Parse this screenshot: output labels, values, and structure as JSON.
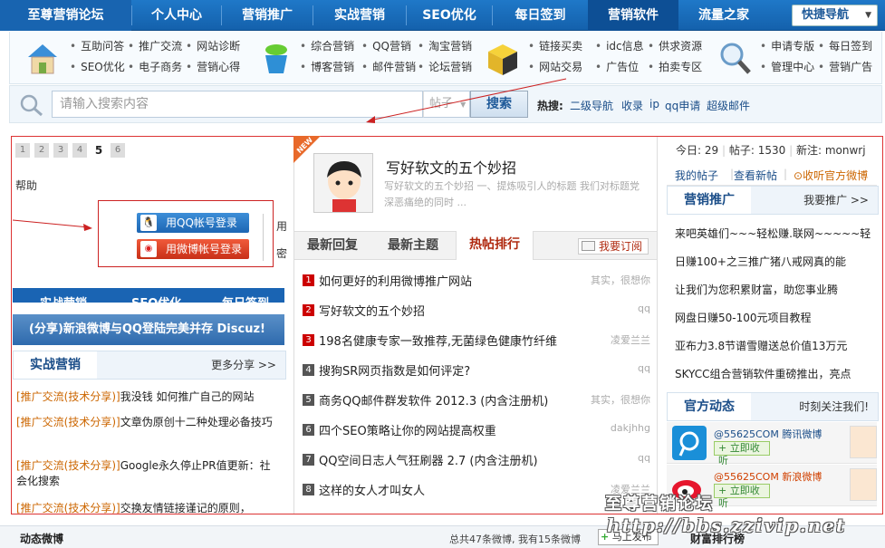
{
  "nav": {
    "items": [
      "至尊营销论坛",
      "个人中心",
      "营销推广",
      "实战营销",
      "SEO优化",
      "每日签到",
      "营销软件",
      "流量之家"
    ],
    "quick_nav": "快捷导航"
  },
  "categories": {
    "g1": [
      "互助问答",
      "推广交流",
      "网站诊断",
      "SEO优化",
      "电子商务",
      "营销心得"
    ],
    "g2": [
      "综合营销",
      "QQ营销",
      "淘宝营销",
      "博客营销",
      "邮件营销",
      "论坛营销"
    ],
    "g3": [
      "链接买卖",
      "idc信息",
      "供求资源",
      "网站交易",
      "广告位",
      "拍卖专区"
    ],
    "g4": [
      "申请专版",
      "每日签到",
      "管理中心",
      "营销广告"
    ]
  },
  "search": {
    "placeholder": "请输入搜索内容",
    "type": "帖子",
    "button": "搜索",
    "hot_label": "热搜:",
    "hot": [
      "二级导航",
      "收录",
      "ip",
      "qq申请",
      "超级邮件"
    ]
  },
  "left": {
    "pager": [
      "1",
      "2",
      "3",
      "4",
      "5",
      "6"
    ],
    "help": "帮助",
    "login_qq": "用QQ帐号登录",
    "login_weibo": "用微博帐号登录",
    "side_char1": "用",
    "side_char2": "密",
    "strip": [
      "实战营销",
      "SEO优化",
      "每日签到"
    ],
    "banner": "(分享)新浪微博与QQ登陆完美并存 Discuz!",
    "section_title": "实战营销",
    "section_more": "更多分享 >>",
    "items": [
      {
        "tag": "[推广交流(技术分享)]",
        "text": "我没钱 如何推广自己的网站"
      },
      {
        "tag": "[推广交流(技术分享)]",
        "text": "文章伪原创十二种处理必备技巧"
      },
      {
        "tag": "[推广交流(技术分享)]",
        "text": "Google永久停止PR值更新：社 会化搜索"
      },
      {
        "tag": "[推广交流(技术分享)]",
        "text": "交换友情链接谨记的原则，"
      }
    ]
  },
  "middle": {
    "new_badge": "NEW",
    "feature_title": "写好软文的五个妙招",
    "feature_desc": "写好软文的五个妙招 一、提炼吸引人的标题 我们对标题党深恶痛绝的同时 ...",
    "tabs": [
      "最新回复",
      "最新主题",
      "热帖排行"
    ],
    "subscribe": "我要订阅",
    "hot_list": [
      {
        "n": "1",
        "title": "如何更好的利用微博推广网站",
        "author": "其实，很想你"
      },
      {
        "n": "2",
        "title": "写好软文的五个妙招",
        "author": "qq"
      },
      {
        "n": "3",
        "title": "198名健康专家一致推荐,无菌绿色健康竹纤维",
        "author": "凌爱兰兰"
      },
      {
        "n": "4",
        "title": "搜狗SR网页指数是如何评定?",
        "author": "qq"
      },
      {
        "n": "5",
        "title": "商务QQ邮件群发软件 2012.3 (内含注册机)",
        "author": "其实，很想你"
      },
      {
        "n": "6",
        "title": "四个SEO策略让你的网站提高权重",
        "author": "dakjhhg"
      },
      {
        "n": "7",
        "title": "QQ空间日志人气狂刷器 2.7 (内含注册机)",
        "author": "qq"
      },
      {
        "n": "8",
        "title": "这样的女人才叫女人",
        "author": "凌爱兰兰"
      }
    ]
  },
  "right": {
    "today_label": "今日:",
    "today": "29",
    "posts_label": "帖子:",
    "posts": "1530",
    "new_label": "新注:",
    "new_user": "monwrj",
    "links": [
      "我的帖子",
      "查看新帖",
      "收听官方微博"
    ],
    "promo_title": "营销推广",
    "promo_more": "我要推广 >>",
    "promo_items": [
      "来吧英雄们~~~轻松赚.联网~~~~~轻",
      "日赚100+之三推广猪八戒网真的能",
      "让我们为您积累财富，助您事业腾",
      "网盘日赚50-100元项目教程",
      "亚布力3.8节谱雪赠送总价值13万元",
      "SKYCC组合营销软件重磅推出，亮点"
    ],
    "official_title": "官方动态",
    "official_more": "时刻关注我们!",
    "weibo": [
      {
        "name": "@55625COM",
        "service": "腾讯微博",
        "follow": "+ 立即收听"
      },
      {
        "name": "@55625COM",
        "service": "新浪微博",
        "follow": "+ 立即收听"
      }
    ]
  },
  "bottom": {
    "left": "动态微博",
    "stats": "总共47条微博, 我有15条微博",
    "post_btn": "马上发布",
    "right": "财富排行榜"
  },
  "watermark": {
    "cn": "至尊营销论坛",
    "url": "http://bbs.zzivip.net"
  },
  "colors": {
    "nav_blue": "#1f78c8",
    "red_frame": "#dd3333",
    "hot_red": "#cc0000"
  }
}
